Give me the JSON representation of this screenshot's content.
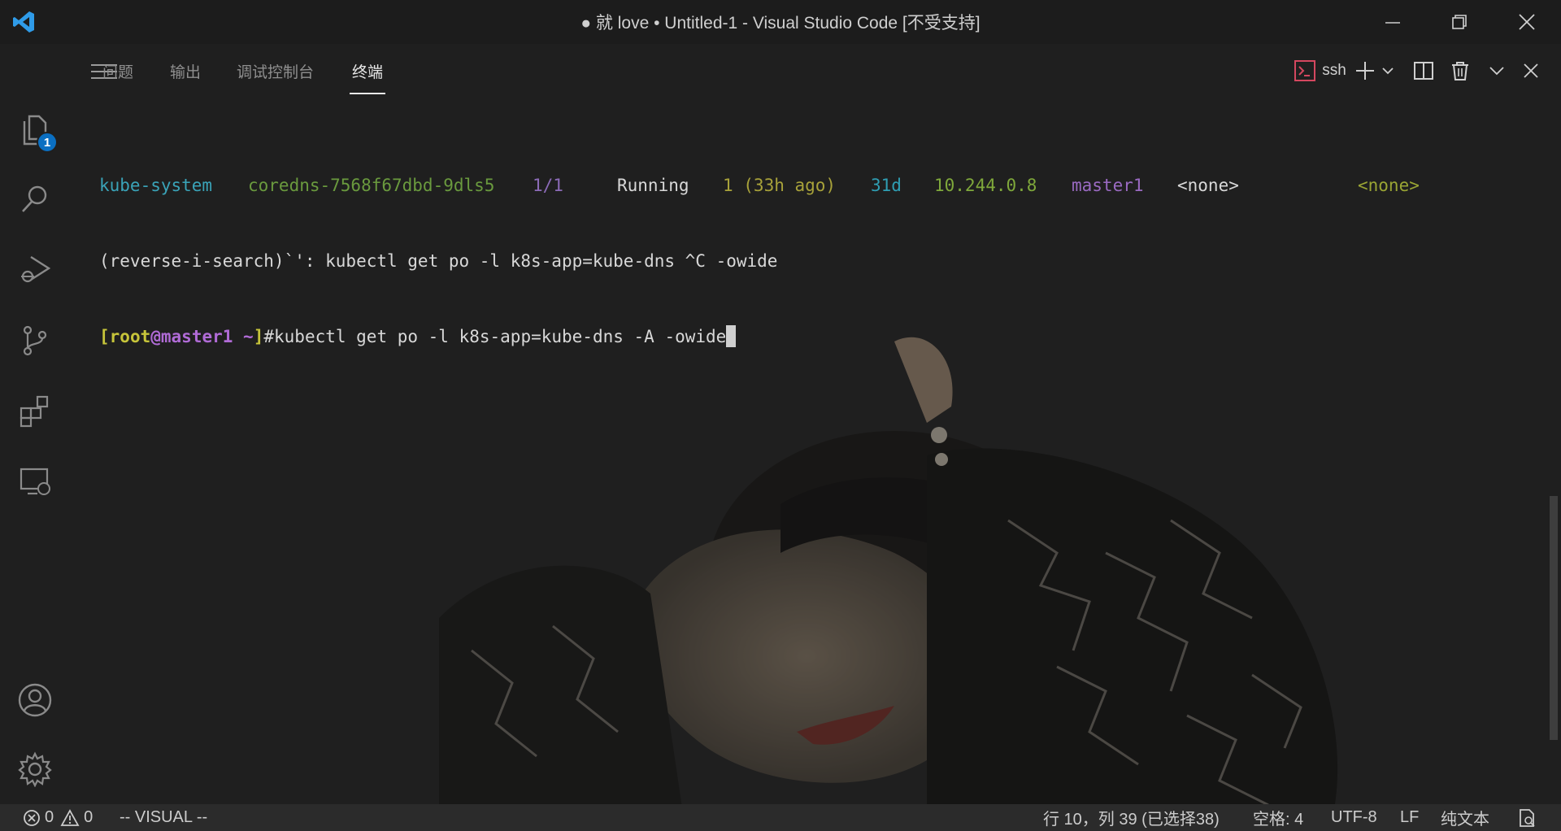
{
  "window": {
    "title": "● 就 love • Untitled-1 - Visual Studio Code [不受支持]"
  },
  "activity_bar": {
    "explorer_badge": "1"
  },
  "panel": {
    "tabs": [
      {
        "label": "问题"
      },
      {
        "label": "输出"
      },
      {
        "label": "调试控制台"
      },
      {
        "label": "终端"
      }
    ],
    "active_tab": "终端",
    "terminal_name": "ssh"
  },
  "terminal": {
    "row1": {
      "namespace": "kube-system",
      "name": "coredns-7568f67dbd-9dls5",
      "ready": "1/1",
      "status": "Running",
      "restarts": "1 (33h ago)",
      "age": "31d",
      "ip": "10.244.0.8",
      "node": "master1",
      "nominated": "<none>",
      "gates": "<none>"
    },
    "line2": "(reverse-i-search)`': kubectl get po -l k8s-app=kube-dns ^C -owide",
    "prompt": {
      "open": "[",
      "user": "root",
      "at": "@",
      "host": "master1",
      "path": " ~",
      "close": "]",
      "symbol": "#"
    },
    "command": "kubectl get po -l k8s-app=kube-dns -A -owide"
  },
  "status_bar": {
    "errors": "0",
    "warnings": "0",
    "mode": "-- VISUAL --",
    "position": "行 10，列 39 (已选择38)",
    "indent": "空格: 4",
    "encoding": "UTF-8",
    "eol": "LF",
    "language": "纯文本"
  },
  "colors": {
    "badge": "#0a6fc2",
    "ssh_icon": "#d4475f",
    "prompt_yellow": "#c6c43a",
    "prompt_purple": "#b06bd6"
  }
}
